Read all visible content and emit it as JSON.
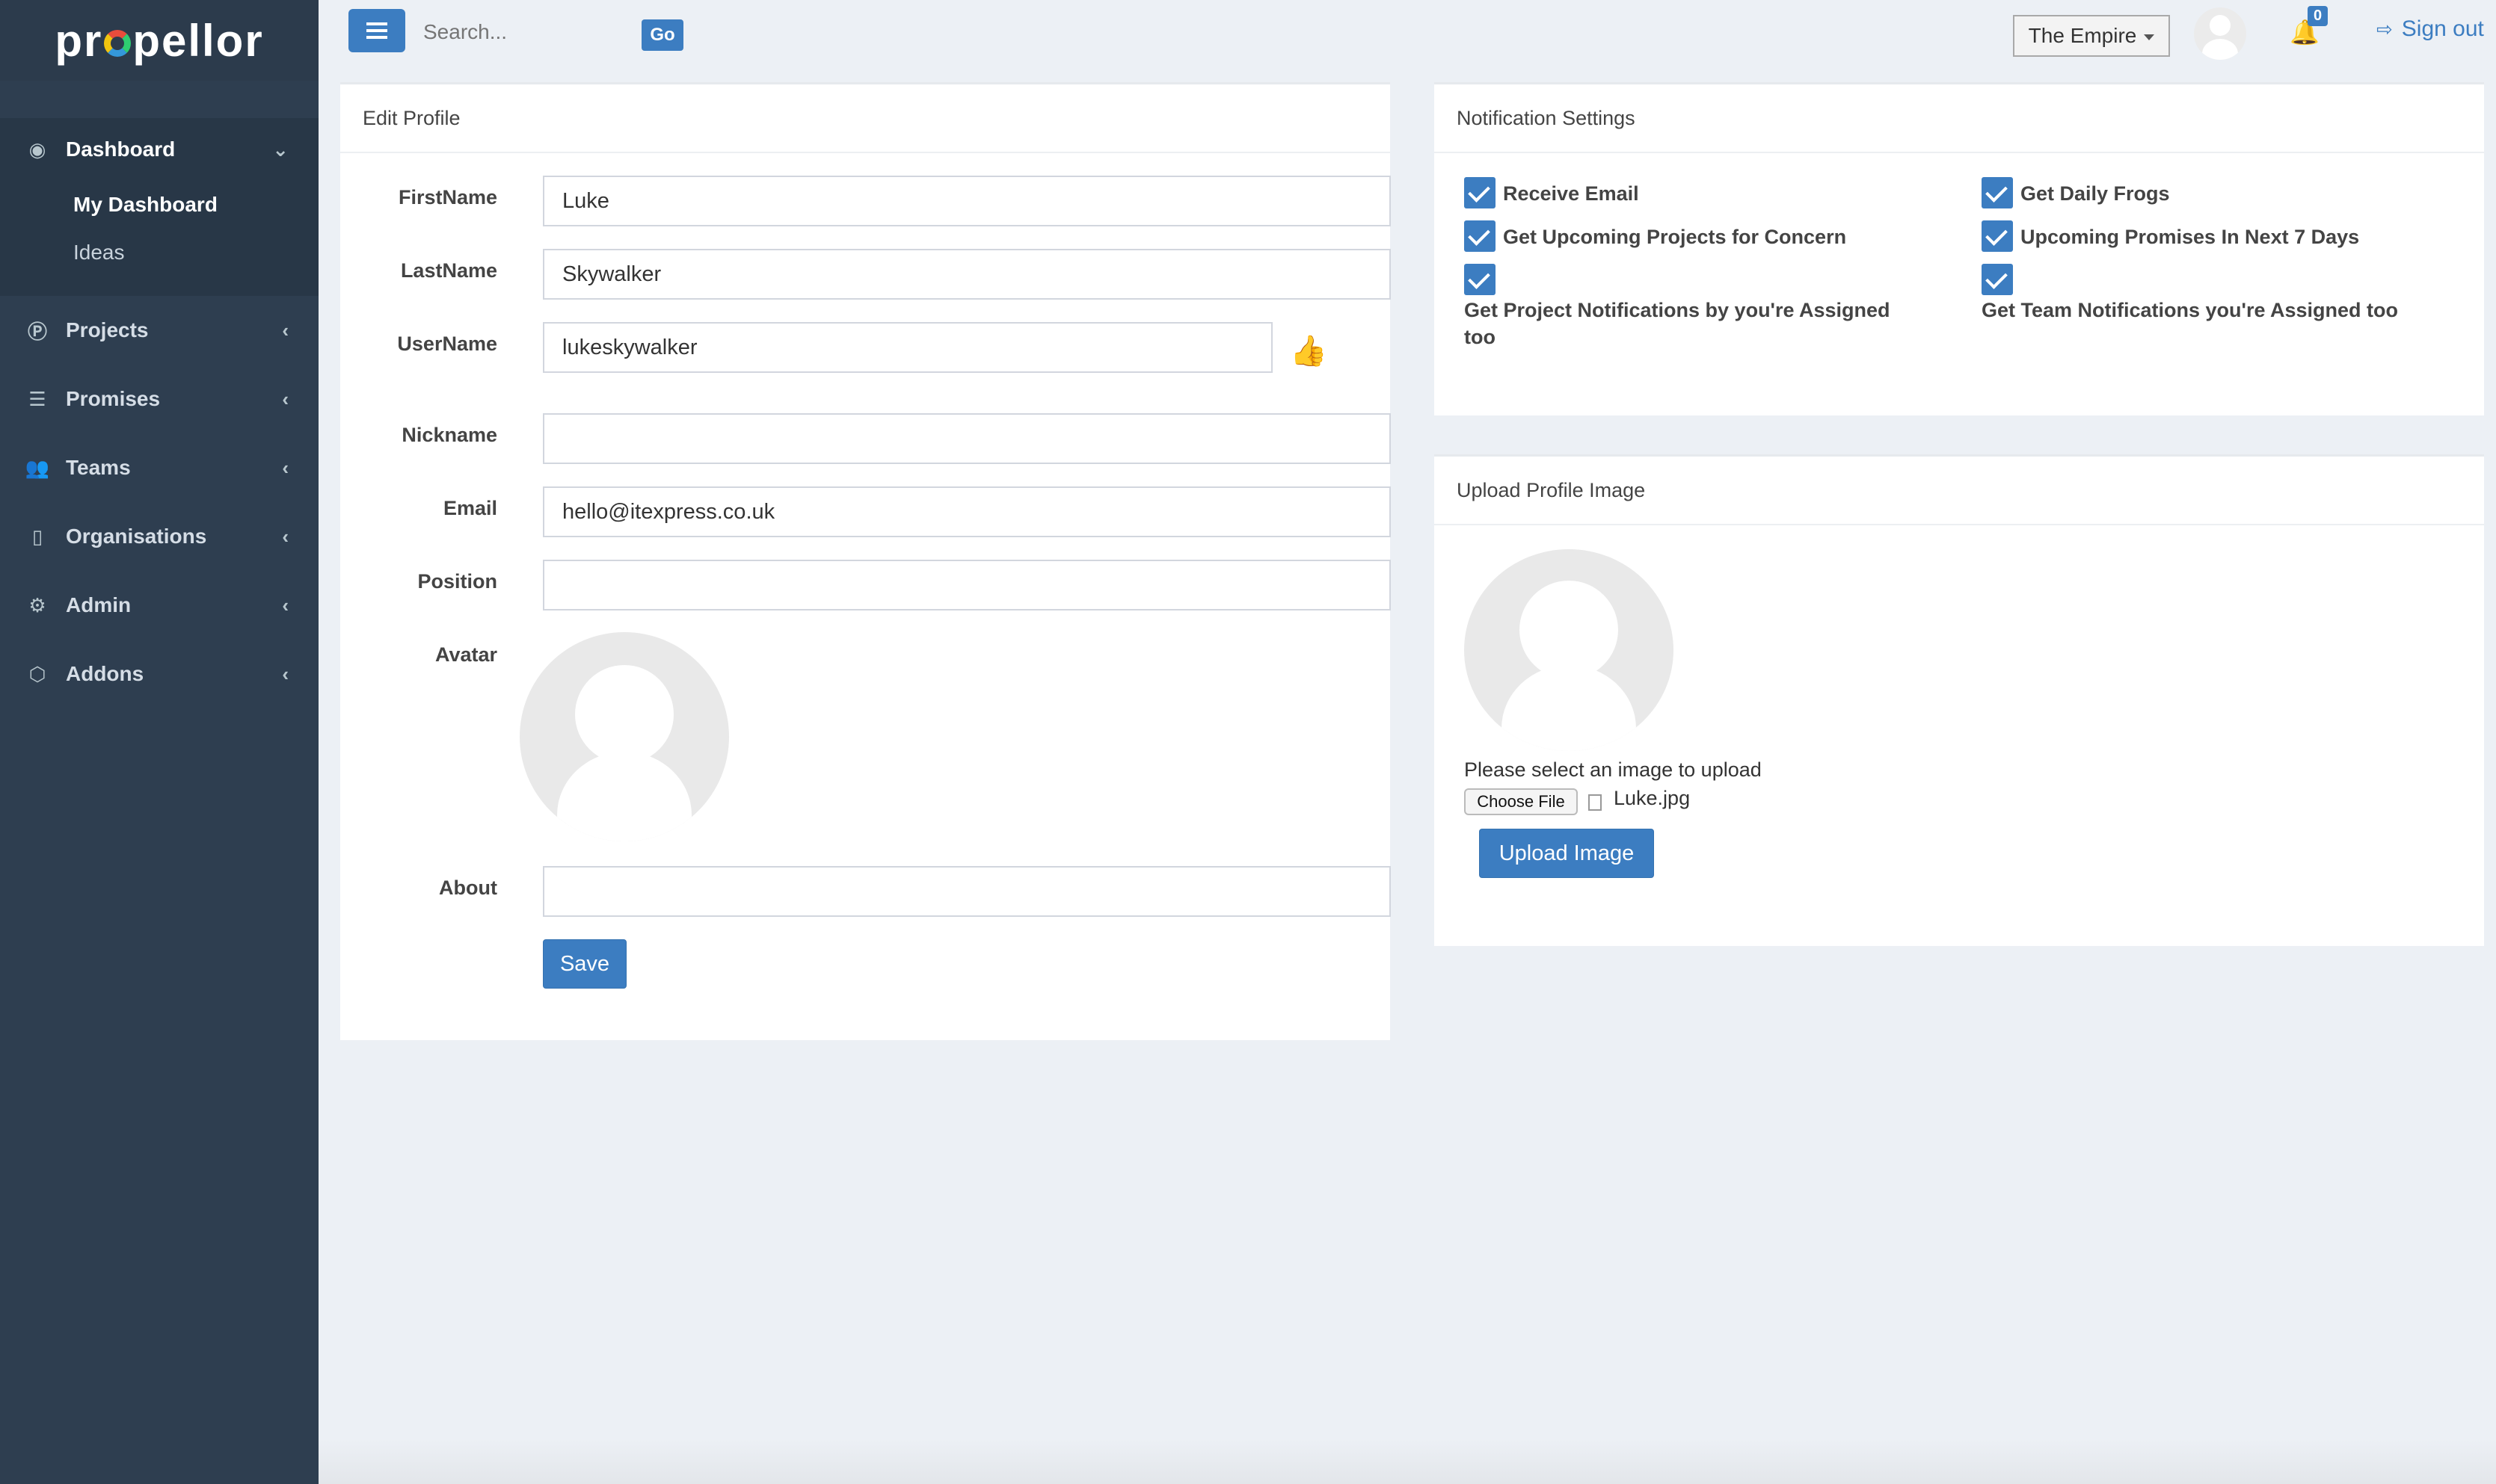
{
  "brand": {
    "name_prefix": "pr",
    "name_suffix": "pellor"
  },
  "sidebar": {
    "dashboard": {
      "label": "Dashboard",
      "items": [
        {
          "label": "My Dashboard"
        },
        {
          "label": "Ideas"
        }
      ]
    },
    "items": [
      {
        "label": "Projects",
        "icon": "p-circle-icon"
      },
      {
        "label": "Promises",
        "icon": "list-icon"
      },
      {
        "label": "Teams",
        "icon": "users-icon"
      },
      {
        "label": "Organisations",
        "icon": "building-icon"
      },
      {
        "label": "Admin",
        "icon": "gear-icon"
      },
      {
        "label": "Addons",
        "icon": "cube-icon"
      }
    ]
  },
  "topbar": {
    "search_placeholder": "Search...",
    "go_label": "Go",
    "org_selected": "The Empire",
    "notification_count": "0",
    "signout_label": "Sign out"
  },
  "edit_profile": {
    "title": "Edit Profile",
    "fields": {
      "firstname": {
        "label": "FirstName",
        "value": "Luke"
      },
      "lastname": {
        "label": "LastName",
        "value": "Skywalker"
      },
      "username": {
        "label": "UserName",
        "value": "lukeskywalker"
      },
      "nickname": {
        "label": "Nickname",
        "value": ""
      },
      "email": {
        "label": "Email",
        "value": "hello@itexpress.co.uk"
      },
      "position": {
        "label": "Position",
        "value": ""
      },
      "avatar": {
        "label": "Avatar"
      },
      "about": {
        "label": "About",
        "value": ""
      }
    },
    "save_label": "Save"
  },
  "notifications": {
    "title": "Notification Settings",
    "options": [
      {
        "label": "Receive Email",
        "checked": true
      },
      {
        "label": "Get Daily Frogs",
        "checked": true
      },
      {
        "label": "Get Upcoming Projects for Concern",
        "checked": true
      },
      {
        "label": "Upcoming Promises In Next 7 Days",
        "checked": true
      },
      {
        "label": "Get Project Notifications by you're Assigned too",
        "checked": true
      },
      {
        "label": "Get Team Notifications you're Assigned too",
        "checked": true
      }
    ]
  },
  "upload": {
    "title": "Upload Profile Image",
    "prompt": "Please select an image to upload",
    "choose_label": "Choose File",
    "file_name": "Luke.jpg",
    "button_label": "Upload Image"
  },
  "colors": {
    "primary": "#3c7dc1",
    "sidebar": "#2e3e50",
    "background": "#ecf0f5"
  }
}
